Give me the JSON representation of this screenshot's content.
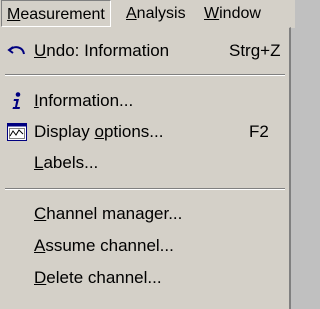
{
  "menubar": {
    "items": [
      {
        "label": "Measurement",
        "accel": "M",
        "rest": "easurement",
        "active": true
      },
      {
        "label": "Analysis",
        "accel": "A",
        "rest": "nalysis",
        "active": false
      },
      {
        "label": "Window",
        "accel": "W",
        "rest": "indow",
        "active": false
      }
    ]
  },
  "menu": {
    "undo": {
      "icon": "undo-icon",
      "accel": "U",
      "rest": "ndo: Information",
      "shortcut": "Strg+Z"
    },
    "information": {
      "icon": "info-icon",
      "accel": "I",
      "rest": "nformation..."
    },
    "display_options": {
      "icon": "display-options-icon",
      "pre": "Display ",
      "accel": "o",
      "rest": "ptions...",
      "shortcut": "F2"
    },
    "labels": {
      "accel": "L",
      "rest": "abels..."
    },
    "channel_manager": {
      "accel": "C",
      "rest": "hannel manager..."
    },
    "assume_channel": {
      "accel": "A",
      "rest": "ssume channel..."
    },
    "delete_channel": {
      "accel": "D",
      "rest": "elete channel..."
    }
  }
}
